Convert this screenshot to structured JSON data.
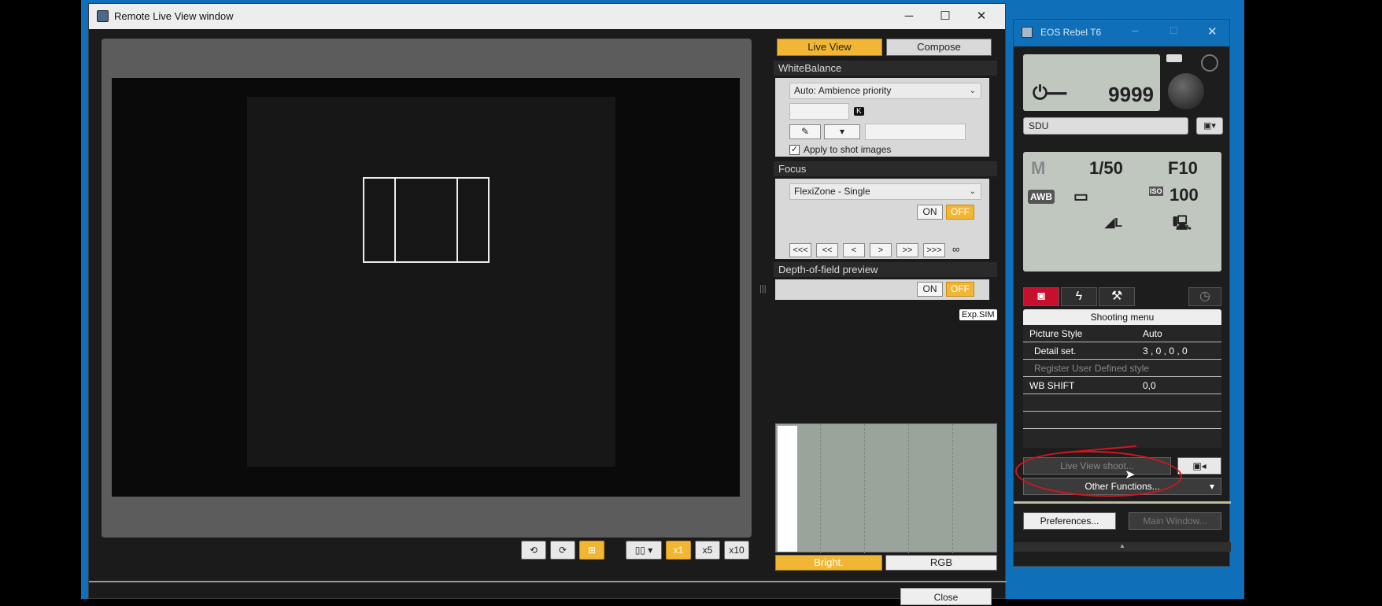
{
  "remote_window": {
    "title": "Remote Live View window",
    "controls": {
      "minimize": "─",
      "maximize": "☐",
      "close": "✕"
    },
    "tabs": [
      "Live View",
      "Compose"
    ],
    "white_balance": {
      "heading": "WhiteBalance",
      "mode": "Auto: Ambience priority",
      "kelvin_unit": "K",
      "apply_label": "Apply to shot images",
      "apply_checked": true
    },
    "focus": {
      "heading": "Focus",
      "mode": "FlexiZone - Single",
      "on_label": "ON",
      "off_label": "OFF",
      "nav": [
        "<<<",
        "<<",
        "<",
        ">",
        ">>",
        ">>>",
        "∞"
      ]
    },
    "dof": {
      "heading": "Depth-of-field preview",
      "on_label": "ON",
      "off_label": "OFF"
    },
    "expsim": "Exp.SIM",
    "histogram_tabs": [
      "Bright.",
      "RGB"
    ],
    "zoom": [
      "x1",
      "x5",
      "x10"
    ],
    "close_label": "Close"
  },
  "eos_window": {
    "title": "EOS Rebel T6",
    "shots_remaining": "9999",
    "card": "SDU",
    "mode": "M",
    "shutter": "1/50",
    "aperture": "F10",
    "wb": "AWB",
    "iso_label": "ISO",
    "iso": "100",
    "tabs": [
      "camera",
      "flash",
      "tools"
    ],
    "menu_title": "Shooting menu",
    "menu": [
      {
        "key": "Picture Style",
        "value": "Auto"
      },
      {
        "key": "Detail set.",
        "value": "3 , 0 , 0 , 0"
      },
      {
        "key": "Register User Defined style",
        "value": ""
      },
      {
        "key": "WB SHIFT",
        "value": "0,0"
      }
    ],
    "live_view_shoot": "Live View shoot...",
    "other_functions": "Other Functions...",
    "preferences": "Preferences...",
    "main_window": "Main Window..."
  },
  "colors": {
    "accent": "#f1b634",
    "annotation": "#d2161e",
    "desktop": "#0f6fb8"
  }
}
